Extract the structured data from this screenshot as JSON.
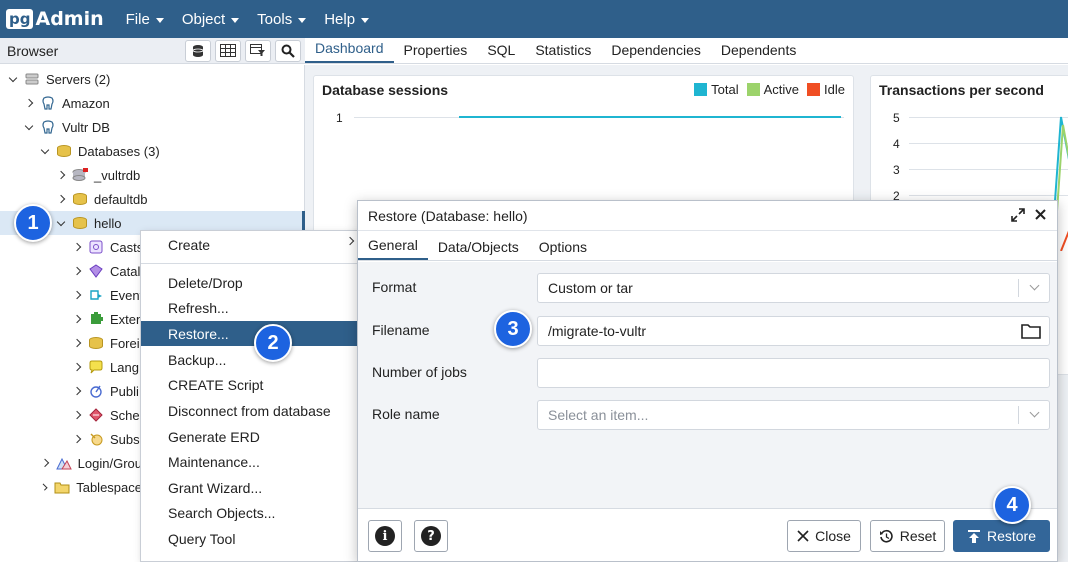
{
  "app": {
    "logo_prefix": "pg",
    "logo_suffix": "Admin",
    "menu": [
      {
        "label": "File"
      },
      {
        "label": "Object"
      },
      {
        "label": "Tools"
      },
      {
        "label": "Help"
      }
    ],
    "accent_color": "#2f5f8a"
  },
  "browser": {
    "title": "Browser",
    "tools": [
      "database-icon",
      "table-icon",
      "filter-icon",
      "search-icon"
    ],
    "tree": [
      {
        "label": "Servers (2)"
      },
      {
        "label": "Amazon"
      },
      {
        "label": "Vultr DB"
      },
      {
        "label": "Databases (3)"
      },
      {
        "label": "_vultrdb"
      },
      {
        "label": "defaultdb"
      },
      {
        "label": "hello"
      },
      {
        "label": "Casts"
      },
      {
        "label": "Catal"
      },
      {
        "label": "Event"
      },
      {
        "label": "Exten"
      },
      {
        "label": "Forei"
      },
      {
        "label": "Lang"
      },
      {
        "label": "Publi"
      },
      {
        "label": "Sche"
      },
      {
        "label": "Subs"
      },
      {
        "label": "Login/Grou"
      },
      {
        "label": "Tablespace"
      }
    ]
  },
  "main_tabs": [
    {
      "label": "Dashboard"
    },
    {
      "label": "Properties"
    },
    {
      "label": "SQL"
    },
    {
      "label": "Statistics"
    },
    {
      "label": "Dependencies"
    },
    {
      "label": "Dependents"
    }
  ],
  "dashboard": {
    "sessions_title": "Database sessions",
    "legend": [
      {
        "label": "Total",
        "color": "#1fb5d1"
      },
      {
        "label": "Active",
        "color": "#9cd36b"
      },
      {
        "label": "Idle",
        "color": "#f04e23"
      }
    ],
    "sessions_tick": "1",
    "tps_title": "Transactions per second",
    "tps_ticks": [
      "5",
      "4",
      "3",
      "2"
    ]
  },
  "context_menu": {
    "items": [
      {
        "label": "Create"
      },
      {
        "label": "Delete/Drop"
      },
      {
        "label": "Refresh..."
      },
      {
        "label": "Restore..."
      },
      {
        "label": "Backup..."
      },
      {
        "label": "CREATE Script"
      },
      {
        "label": "Disconnect from database"
      },
      {
        "label": "Generate ERD"
      },
      {
        "label": "Maintenance..."
      },
      {
        "label": "Grant Wizard..."
      },
      {
        "label": "Search Objects..."
      },
      {
        "label": "Query Tool"
      }
    ]
  },
  "dialog": {
    "title": "Restore (Database: hello)",
    "tabs": [
      {
        "label": "General"
      },
      {
        "label": "Data/Objects"
      },
      {
        "label": "Options"
      }
    ],
    "fields": {
      "format_label": "Format",
      "format_value": "Custom or tar",
      "filename_label": "Filename",
      "filename_value": "/migrate-to-vultr",
      "jobs_label": "Number of jobs",
      "jobs_value": "",
      "role_label": "Role name",
      "role_placeholder": "Select an item..."
    },
    "buttons": {
      "info": "i",
      "help": "?",
      "close": "Close",
      "reset": "Reset",
      "restore": "Restore"
    }
  },
  "callouts": [
    "1",
    "2",
    "3",
    "4"
  ]
}
